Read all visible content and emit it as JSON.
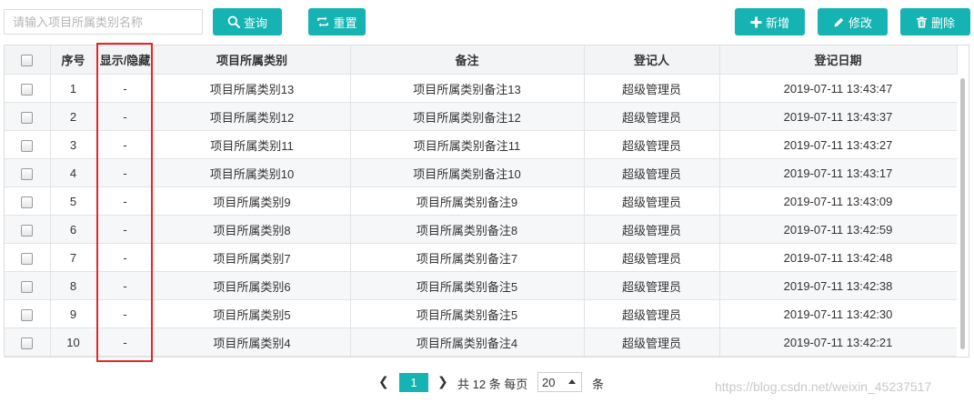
{
  "toolbar": {
    "search_placeholder": "请输入项目所属类别名称",
    "query_label": "查询",
    "reset_label": "重置",
    "add_label": "新增",
    "edit_label": "修改",
    "delete_label": "删除"
  },
  "table": {
    "columns": [
      "序号",
      "显示/隐藏",
      "项目所属类别",
      "备注",
      "登记人",
      "登记日期"
    ],
    "rows": [
      {
        "index": "1",
        "visible": "-",
        "category": "项目所属类别13",
        "remark": "项目所属类别备注13",
        "registrar": "超级管理员",
        "date": "2019-07-11 13:43:47"
      },
      {
        "index": "2",
        "visible": "-",
        "category": "项目所属类别12",
        "remark": "项目所属类别备注12",
        "registrar": "超级管理员",
        "date": "2019-07-11 13:43:37"
      },
      {
        "index": "3",
        "visible": "-",
        "category": "项目所属类别11",
        "remark": "项目所属类别备注11",
        "registrar": "超级管理员",
        "date": "2019-07-11 13:43:27"
      },
      {
        "index": "4",
        "visible": "-",
        "category": "项目所属类别10",
        "remark": "项目所属类别备注10",
        "registrar": "超级管理员",
        "date": "2019-07-11 13:43:17"
      },
      {
        "index": "5",
        "visible": "-",
        "category": "项目所属类别9",
        "remark": "项目所属类别备注9",
        "registrar": "超级管理员",
        "date": "2019-07-11 13:43:09"
      },
      {
        "index": "6",
        "visible": "-",
        "category": "项目所属类别8",
        "remark": "项目所属类别备注8",
        "registrar": "超级管理员",
        "date": "2019-07-11 13:42:59"
      },
      {
        "index": "7",
        "visible": "-",
        "category": "项目所属类别7",
        "remark": "项目所属类别备注7",
        "registrar": "超级管理员",
        "date": "2019-07-11 13:42:48"
      },
      {
        "index": "8",
        "visible": "-",
        "category": "项目所属类别6",
        "remark": "项目所属类别备注5",
        "registrar": "超级管理员",
        "date": "2019-07-11 13:42:38"
      },
      {
        "index": "9",
        "visible": "-",
        "category": "项目所属类别5",
        "remark": "项目所属类别备注5",
        "registrar": "超级管理员",
        "date": "2019-07-11 13:42:30"
      },
      {
        "index": "10",
        "visible": "-",
        "category": "项目所属类别4",
        "remark": "项目所属类别备注4",
        "registrar": "超级管理员",
        "date": "2019-07-11 13:42:21"
      }
    ]
  },
  "pager": {
    "prev": "❮",
    "current_page": "1",
    "next": "❯",
    "total_text": "共 12 条 每页",
    "page_size": "20",
    "unit": "条"
  },
  "watermark": "https://blog.csdn.net/weixin_45237517",
  "colors": {
    "accent": "#16b3b3",
    "highlight": "#e0282c",
    "header_bg": "#f2f4f5",
    "stripe_bg": "#f5f7f9"
  },
  "icons": {
    "query": "search-icon",
    "reset": "refresh-icon",
    "add": "plus-icon",
    "edit": "pencil-icon",
    "delete": "trash-icon",
    "page_size": "caret-up-icon"
  }
}
